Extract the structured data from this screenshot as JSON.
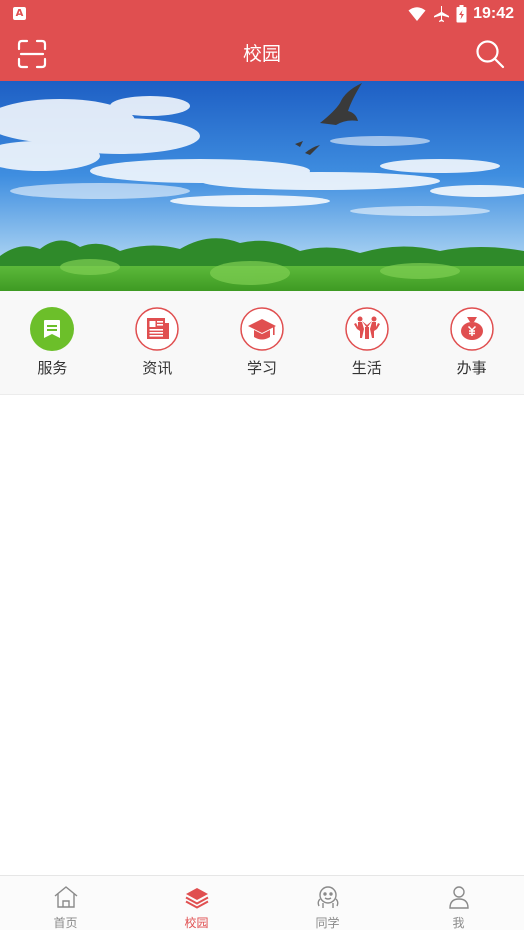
{
  "status_bar": {
    "time": "19:42",
    "notif_icon": "A"
  },
  "header": {
    "title": "校园",
    "left_icon": "scan-icon",
    "right_icon": "search-icon"
  },
  "colors": {
    "brand": "#e04f50",
    "service_green": "#6cbf2a",
    "tab_inactive": "#8a8a8a"
  },
  "quick_menu": [
    {
      "label": "服务",
      "icon": "service-icon"
    },
    {
      "label": "资讯",
      "icon": "news-icon"
    },
    {
      "label": "学习",
      "icon": "study-icon"
    },
    {
      "label": "生活",
      "icon": "life-icon"
    },
    {
      "label": "办事",
      "icon": "affairs-icon"
    }
  ],
  "tab_bar": [
    {
      "label": "首页",
      "icon": "home-icon",
      "active": false
    },
    {
      "label": "校园",
      "icon": "campus-icon",
      "active": true
    },
    {
      "label": "同学",
      "icon": "classmates-icon",
      "active": false
    },
    {
      "label": "我",
      "icon": "profile-icon",
      "active": false
    }
  ]
}
